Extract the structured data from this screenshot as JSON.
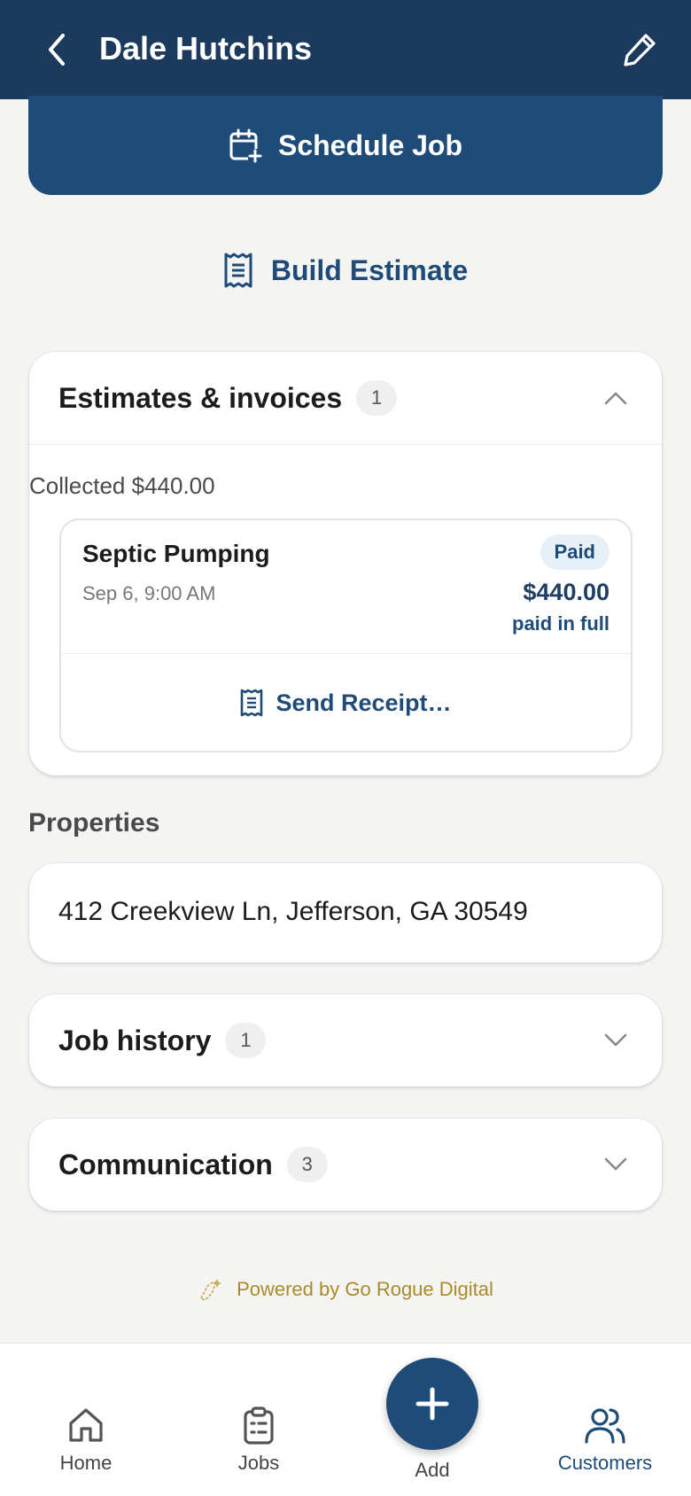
{
  "header": {
    "title": "Dale Hutchins",
    "back_icon": "chevron-left-icon",
    "edit_icon": "pencil-icon"
  },
  "actions": {
    "schedule_label": "Schedule Job",
    "build_estimate_label": "Build Estimate"
  },
  "estimates": {
    "heading": "Estimates & invoices",
    "count": "1",
    "collected": "Collected $440.00",
    "invoice": {
      "title": "Septic Pumping",
      "date": "Sep 6, 9:00 AM",
      "status": "Paid",
      "amount": "$440.00",
      "amount_note": "paid in full",
      "send_label": "Send Receipt…"
    }
  },
  "properties": {
    "heading": "Properties",
    "address": "412 Creekview Ln, Jefferson, GA 30549"
  },
  "job_history": {
    "heading": "Job history",
    "count": "1"
  },
  "communication": {
    "heading": "Communication",
    "count": "3"
  },
  "footer": {
    "powered_by": "Powered by Go Rogue Digital"
  },
  "nav": {
    "home": "Home",
    "jobs": "Jobs",
    "add": "Add",
    "customers": "Customers",
    "active": "customers"
  },
  "colors": {
    "primary": "#1e4b77",
    "header_bg": "#1b3a5c",
    "accent_gold": "#a98b2c",
    "background": "#f4f4f3"
  }
}
